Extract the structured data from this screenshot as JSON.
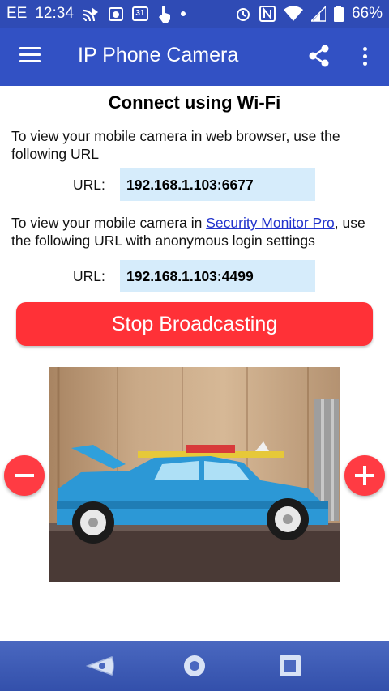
{
  "status_bar": {
    "carrier": "EE",
    "time": "12:34",
    "calendar_day": "31",
    "battery": "66%",
    "icons": [
      "cast-icon",
      "camera-notification-icon",
      "calendar-icon",
      "touch-icon",
      "dot-icon",
      "alarm-icon",
      "nfc-icon",
      "wifi-icon",
      "signal-icon",
      "battery-icon"
    ]
  },
  "app_bar": {
    "title": "IP Phone Camera",
    "icons": [
      "menu-icon",
      "share-icon",
      "more-vert-icon"
    ]
  },
  "main": {
    "heading": "Connect using Wi-Fi",
    "browser_text": "To view your mobile camera in web browser, use the following URL",
    "url_label": "URL:",
    "browser_url": "192.168.1.103:6677",
    "monitor_text_before": "To view your mobile camera in ",
    "monitor_link": "Security Monitor Pro",
    "monitor_text_after": ", use the following URL with anonymous login settings",
    "monitor_url": "192.168.1.103:4499",
    "stop_button": "Stop Broadcasting"
  },
  "preview": {
    "subject": "camera preview of a blue toy car"
  },
  "nav_bar": {
    "icons": [
      "back-icon",
      "home-icon",
      "recents-icon"
    ]
  },
  "colors": {
    "status_bar": "#2f4bb5",
    "app_bar": "#3251c4",
    "url_field": "#d6ecfb",
    "stop_button": "#ff3137",
    "zoom_button": "#ff3b43",
    "link": "#2233cc"
  }
}
